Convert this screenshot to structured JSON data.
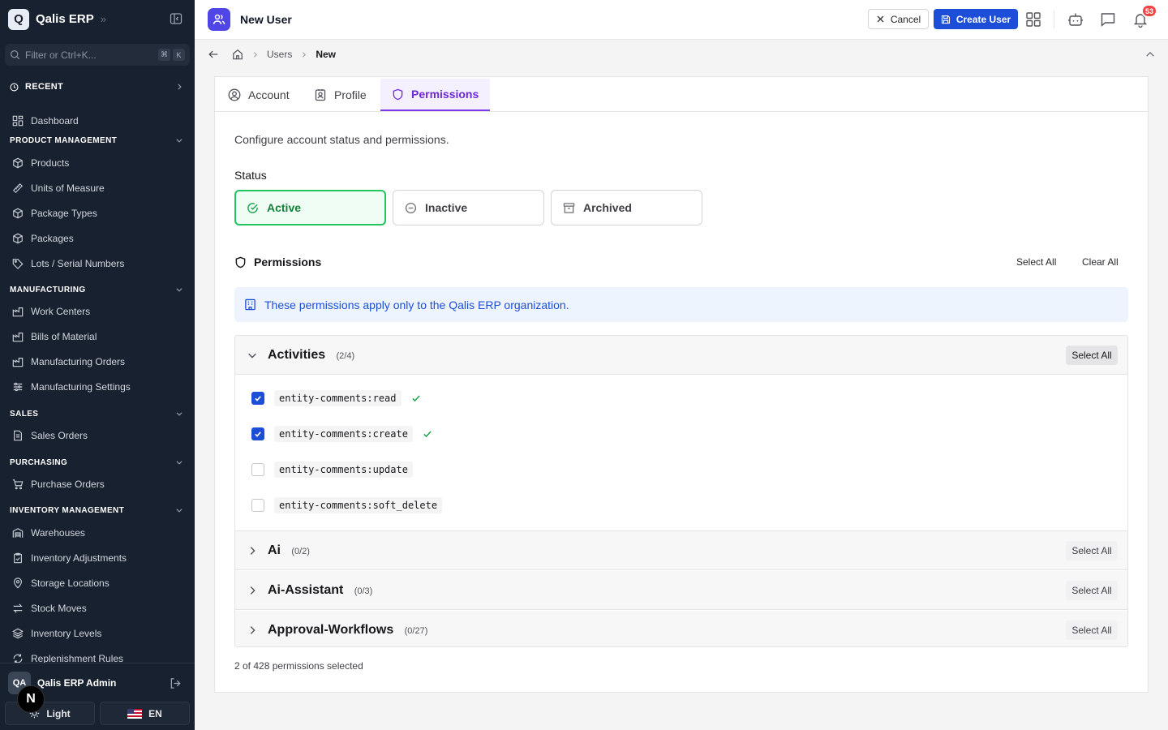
{
  "app": {
    "logo_letter": "Q",
    "name": "Qalis ERP",
    "brand_chevron": "»"
  },
  "sidebar": {
    "filter_placeholder": "Filter or Ctrl+K...",
    "filter_keys": [
      "⌘",
      "K"
    ],
    "recent_label": "RECENT",
    "dashboard": "Dashboard",
    "sections": {
      "product": {
        "title": "PRODUCT MANAGEMENT",
        "items": [
          "Products",
          "Units of Measure",
          "Package Types",
          "Packages",
          "Lots / Serial Numbers"
        ]
      },
      "manufacturing": {
        "title": "MANUFACTURING",
        "items": [
          "Work Centers",
          "Bills of Material",
          "Manufacturing Orders",
          "Manufacturing Settings"
        ]
      },
      "sales": {
        "title": "SALES",
        "items": [
          "Sales Orders"
        ]
      },
      "purchasing": {
        "title": "PURCHASING",
        "items": [
          "Purchase Orders"
        ]
      },
      "inventory": {
        "title": "INVENTORY MANAGEMENT",
        "items": [
          "Warehouses",
          "Inventory Adjustments",
          "Storage Locations",
          "Stock Moves",
          "Inventory Levels",
          "Replenishment Rules"
        ]
      }
    },
    "user": {
      "initials": "QA",
      "name": "Qalis ERP Admin"
    },
    "dev_badge": "N",
    "theme_label": "Light",
    "lang_label": "EN"
  },
  "header": {
    "title": "New User",
    "cancel_label": "Cancel",
    "create_label": "Create User",
    "notification_count": "53"
  },
  "breadcrumb": {
    "items": [
      "Users",
      "New"
    ]
  },
  "tabs": [
    "Account",
    "Profile",
    "Permissions"
  ],
  "form": {
    "description": "Configure account status and permissions.",
    "status_label": "Status",
    "status_options": [
      "Active",
      "Inactive",
      "Archived"
    ],
    "selected_status": "Active",
    "permissions_title": "Permissions",
    "select_all": "Select All",
    "clear_all": "Clear All",
    "info_text": "These permissions apply only to the Qalis ERP organization."
  },
  "groups": [
    {
      "name": "Activities",
      "count": "(2/4)",
      "expanded": true,
      "select_label": "Select All",
      "permissions": [
        {
          "code": "entity-comments:read",
          "checked": true
        },
        {
          "code": "entity-comments:create",
          "checked": true
        },
        {
          "code": "entity-comments:update",
          "checked": false
        },
        {
          "code": "entity-comments:soft_delete",
          "checked": false
        }
      ]
    },
    {
      "name": "Ai",
      "count": "(0/2)",
      "expanded": false,
      "select_label": "Select All"
    },
    {
      "name": "Ai-Assistant",
      "count": "(0/3)",
      "expanded": false,
      "select_label": "Select All"
    },
    {
      "name": "Approval-Workflows",
      "count": "(0/27)",
      "expanded": false,
      "select_label": "Select All"
    }
  ],
  "footer": {
    "selected_summary": "2 of 428 permissions selected"
  },
  "colors": {
    "sidebar_bg": "#18212f",
    "primary": "#1d4ed8",
    "tab_active": "#7c3aed",
    "status_active": "#22c55e",
    "badge": "#ef4444"
  }
}
